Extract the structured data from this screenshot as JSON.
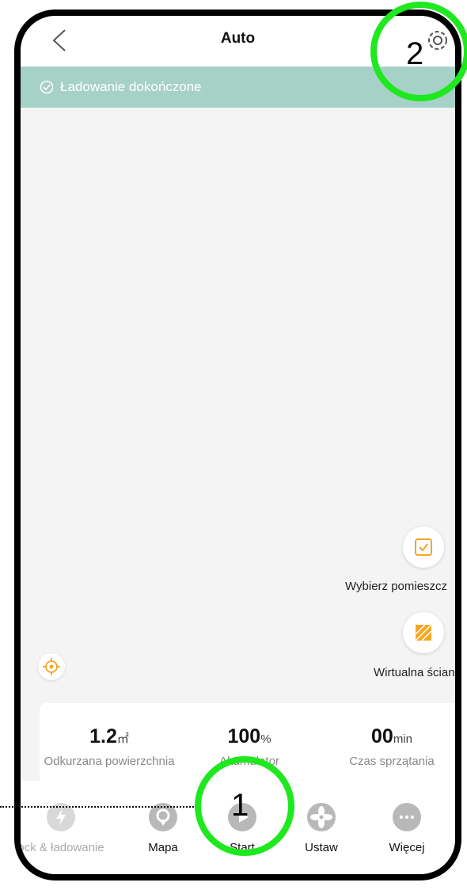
{
  "header": {
    "title": "Auto",
    "back_icon": "chevron-left-icon",
    "settings_icon": "gear-icon"
  },
  "status": {
    "text": "Ładowanie dokończone",
    "icon": "check-circle-icon",
    "color": "#a6d1c6"
  },
  "map_actions": [
    {
      "label": "Wybierz pomieszcz",
      "icon": "select-room-icon"
    },
    {
      "label": "Wirtualna ściana",
      "icon": "virtual-wall-icon"
    }
  ],
  "stats": [
    {
      "value": "1.2",
      "unit": "㎡",
      "label": "Odkurzana powierzchnia"
    },
    {
      "value": "100",
      "unit": "%",
      "label": "Akumulator"
    },
    {
      "value": "00",
      "unit": "min",
      "label": "Czas sprzątania"
    }
  ],
  "nav": [
    {
      "label": "ock & ładowanie",
      "icon": "dock-charge-icon"
    },
    {
      "label": "Mapa",
      "icon": "map-pin-icon"
    },
    {
      "label": "Start",
      "icon": "play-icon"
    },
    {
      "label": "Ustaw",
      "icon": "fan-icon"
    },
    {
      "label": "Więcej",
      "icon": "more-icon"
    }
  ],
  "annotations": {
    "one": "1",
    "two": "2"
  },
  "colors": {
    "accent": "#f5a623",
    "highlight": "#1ee81e"
  }
}
